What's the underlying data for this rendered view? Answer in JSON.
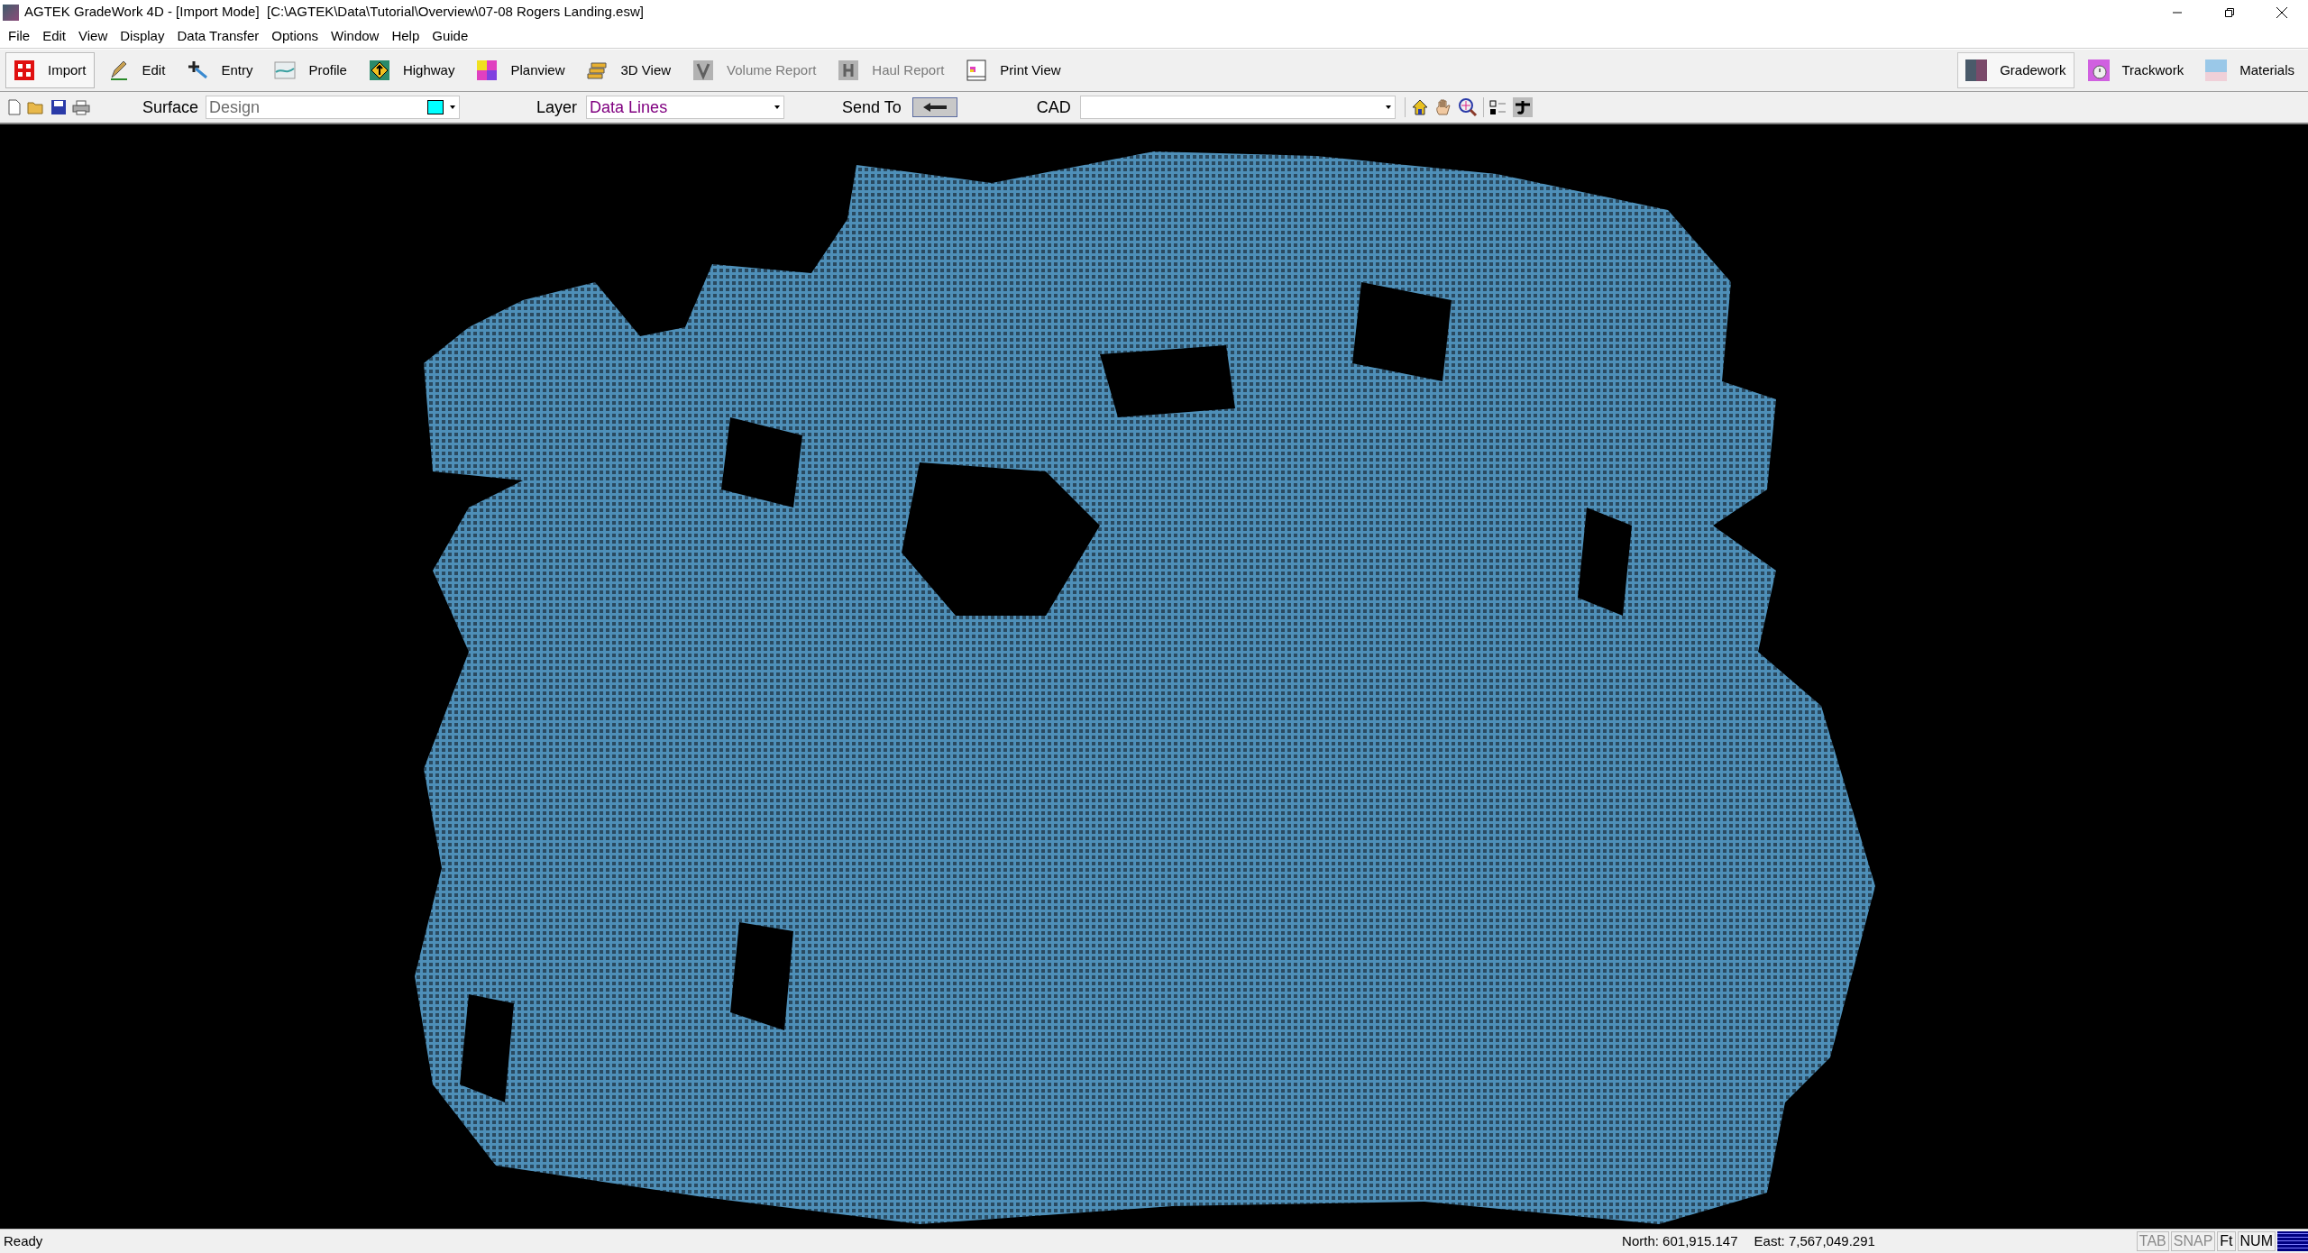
{
  "window": {
    "title": "AGTEK GradeWork 4D - [Import Mode]  [C:\\AGTEK\\Data\\Tutorial\\Overview\\07-08 Rogers Landing.esw]"
  },
  "menu": [
    "File",
    "Edit",
    "View",
    "Display",
    "Data Transfer",
    "Options",
    "Window",
    "Help",
    "Guide"
  ],
  "modes": [
    {
      "label": "Import",
      "selected": true,
      "disabled": false
    },
    {
      "label": "Edit",
      "selected": false,
      "disabled": false
    },
    {
      "label": "Entry",
      "selected": false,
      "disabled": false
    },
    {
      "label": "Profile",
      "selected": false,
      "disabled": false
    },
    {
      "label": "Highway",
      "selected": false,
      "disabled": false
    },
    {
      "label": "Planview",
      "selected": false,
      "disabled": false
    },
    {
      "label": "3D View",
      "selected": false,
      "disabled": false
    },
    {
      "label": "Volume Report",
      "selected": false,
      "disabled": true
    },
    {
      "label": "Haul Report",
      "selected": false,
      "disabled": true
    },
    {
      "label": "Print View",
      "selected": false,
      "disabled": false
    }
  ],
  "products": [
    {
      "label": "Gradework",
      "selected": true
    },
    {
      "label": "Trackwork",
      "selected": false
    },
    {
      "label": "Materials",
      "selected": false
    }
  ],
  "surface": {
    "label": "Surface",
    "value": "Design",
    "color": "#00ffff"
  },
  "layer": {
    "label": "Layer",
    "value": "Data Lines"
  },
  "send_to": {
    "label": "Send To"
  },
  "cad": {
    "label": "CAD"
  },
  "status_bar": {
    "message": "Ready",
    "north": "North: 601,915.147",
    "east": "East: 7,567,049.291",
    "indicators": [
      {
        "label": "TAB",
        "on": false
      },
      {
        "label": "SNAP",
        "on": false
      },
      {
        "label": "Ft",
        "on": true
      },
      {
        "label": "NUM",
        "on": true
      }
    ]
  }
}
